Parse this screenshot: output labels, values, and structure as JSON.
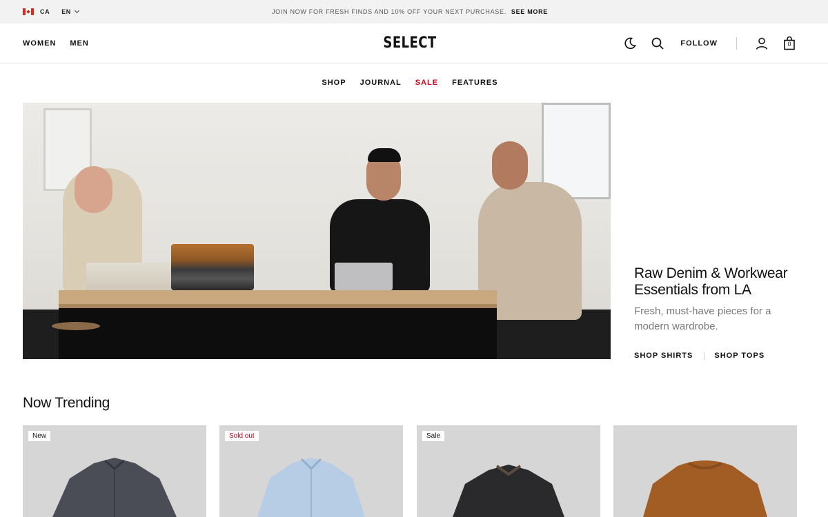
{
  "topbar": {
    "country": "CA",
    "language": "EN",
    "announcement": "JOIN NOW FOR FRESH FINDS AND 10% OFF YOUR NEXT PURCHASE.",
    "see_more": "SEE MORE",
    "flag_icon": "canada-flag-icon"
  },
  "header": {
    "nav": [
      "WOMEN",
      "MEN"
    ],
    "logo": "SELECT",
    "follow": "FOLLOW",
    "cart_count": "0",
    "icons": [
      "moon-icon",
      "search-icon",
      "user-icon",
      "shopping-bag-icon"
    ]
  },
  "subnav": {
    "items": [
      "SHOP",
      "JOURNAL",
      "SALE",
      "FEATURES"
    ],
    "sale_color": "#d0021b"
  },
  "hero": {
    "title": "Raw Denim & Workwear Essentials from LA",
    "subtitle": "Fresh, must-have pieces for a modern wardrobe.",
    "link_1": "SHOP SHIRTS",
    "link_2": "SHOP TOPS"
  },
  "trending": {
    "title": "Now Trending",
    "cards": [
      {
        "badge": "New",
        "color": "#4a4d55"
      },
      {
        "badge": "Sold out",
        "color": "#b7cde6"
      },
      {
        "badge": "Sale",
        "color": "#2a2a2c"
      },
      {
        "badge": "",
        "color": "#a25d25"
      }
    ]
  }
}
